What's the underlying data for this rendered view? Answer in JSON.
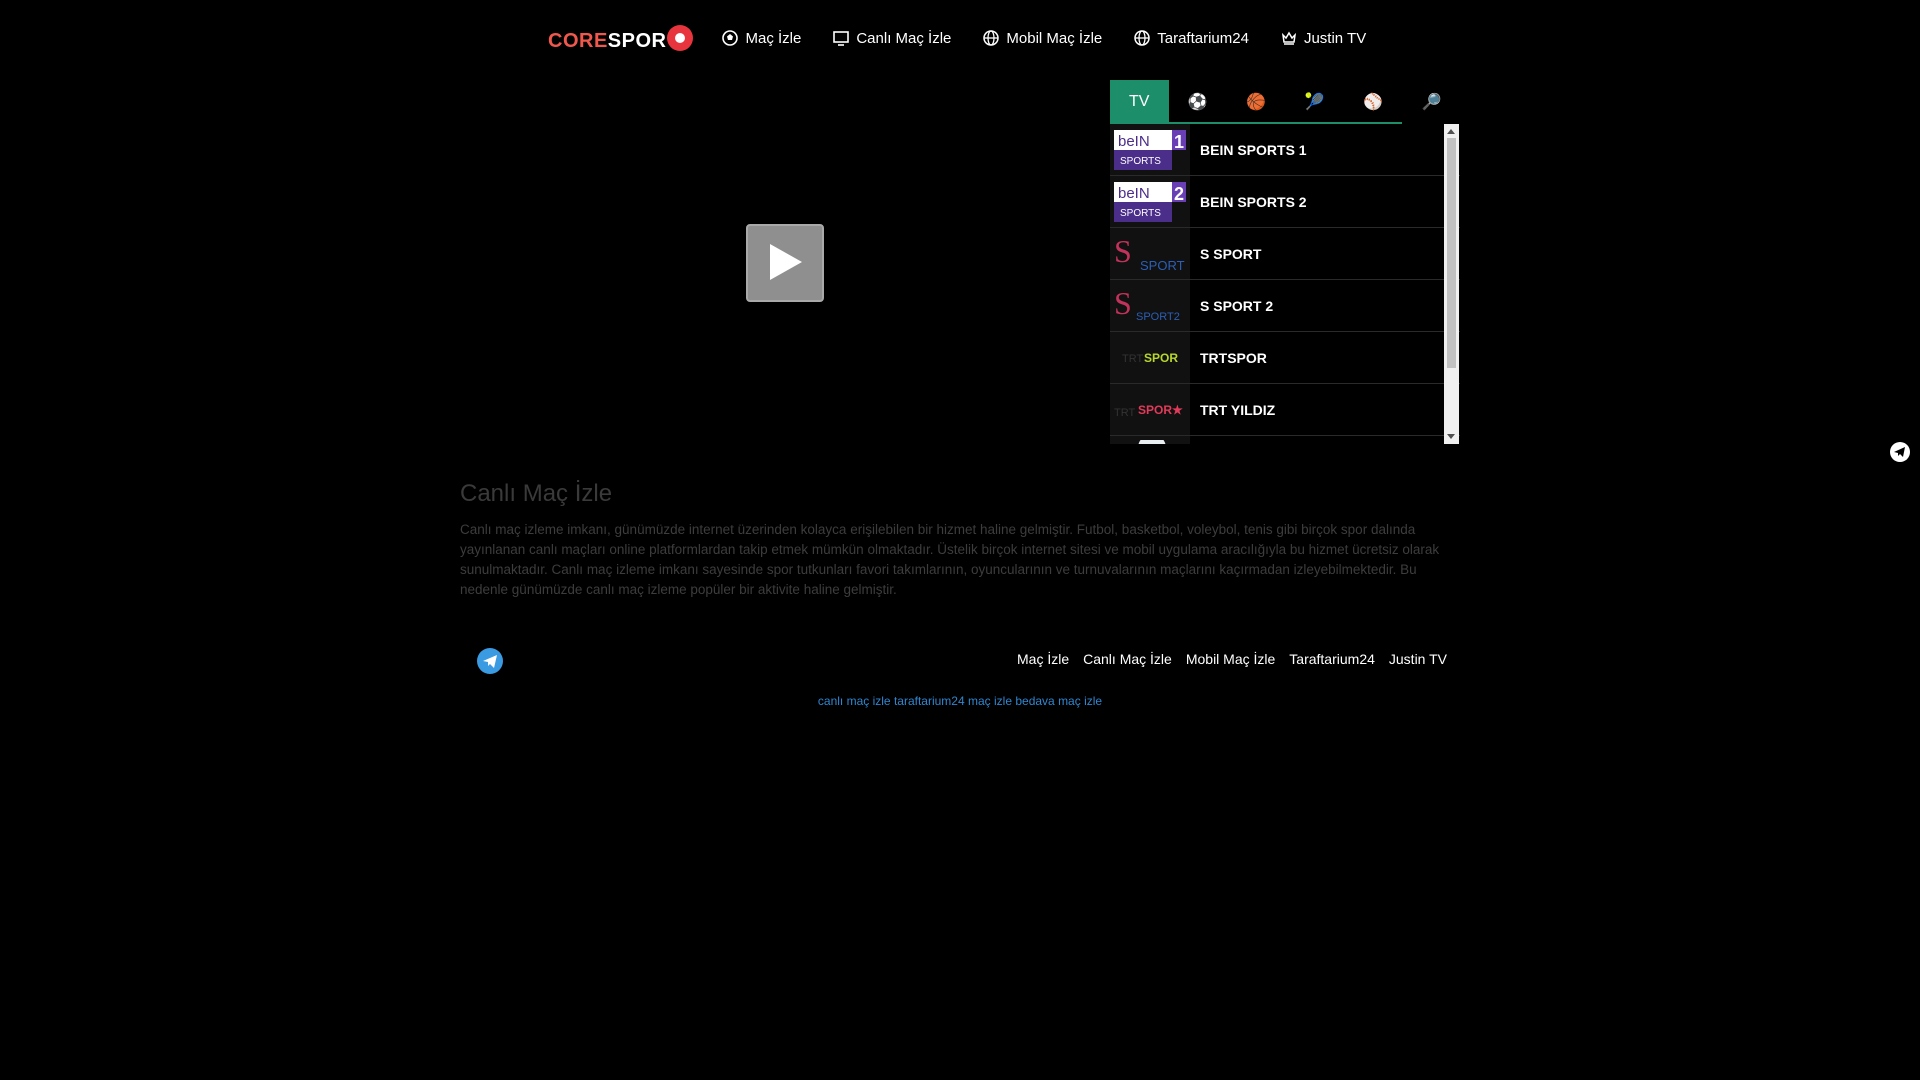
{
  "header": {
    "logo": {
      "part1": "CORE",
      "part2": "SPOR"
    },
    "nav": [
      {
        "label": "Maç İzle",
        "icon": "soccer-ball-icon"
      },
      {
        "label": "Canlı Maç İzle",
        "icon": "monitor-icon"
      },
      {
        "label": "Mobil Maç İzle",
        "icon": "globe-icon"
      },
      {
        "label": "Taraftarium24",
        "icon": "globe-icon"
      },
      {
        "label": "Justin TV",
        "icon": "crown-icon"
      }
    ]
  },
  "tabs": [
    {
      "label": "TV",
      "icon": "tv-tab"
    },
    {
      "label": "⚽",
      "icon": "football-icon"
    },
    {
      "label": "🏀",
      "icon": "basketball-icon"
    },
    {
      "label": "🎾",
      "icon": "tennis-icon"
    },
    {
      "label": "⚾",
      "icon": "baseball-icon"
    },
    {
      "label": "🔎",
      "icon": "search-icon"
    }
  ],
  "channels": [
    {
      "name": "BEIN SPORTS 1",
      "logo_text": "1"
    },
    {
      "name": "BEIN SPORTS 2",
      "logo_text": "2"
    },
    {
      "name": "S SPORT",
      "logo_text": "SPORT"
    },
    {
      "name": "S SPORT 2",
      "logo_text": "SPORT2"
    },
    {
      "name": "TRTSPOR",
      "logo_text": "SPOR"
    },
    {
      "name": "TRT YILDIZ",
      "logo_text": "SPOR★"
    }
  ],
  "article": {
    "title": "Canlı Maç İzle",
    "body": "Canlı maç izleme imkanı, günümüzde internet üzerinden kolayca erişilebilen bir hizmet haline gelmiştir. Futbol, basketbol, voleybol, tenis gibi birçok spor dalında yayınlanan canlı maçları online platformlardan takip etmek mümkün olmaktadır. Üstelik birçok internet sitesi ve mobil uygulama aracılığıyla bu hizmet ücretsiz olarak sunulmaktadır. Canlı maç izleme imkanı sayesinde spor tutkunları favori takımlarının, oyuncularının ve turnuvalarının maçlarını kaçırmadan izleyebilmektedir. Bu nedenle günümüzde canlı maç izleme popüler bir aktivite haline gelmiştir."
  },
  "footer": {
    "links": [
      "Maç İzle",
      "Canlı Maç İzle",
      "Mobil Maç İzle",
      "Taraftarium24",
      "Justin TV"
    ],
    "tags": [
      "canlı maç izle",
      "taraftarium24",
      "maç izle",
      "bedava maç izle"
    ]
  },
  "colors": {
    "accent": "#1c8f6a",
    "brand": "#f0584d",
    "link": "#2f86d0"
  }
}
